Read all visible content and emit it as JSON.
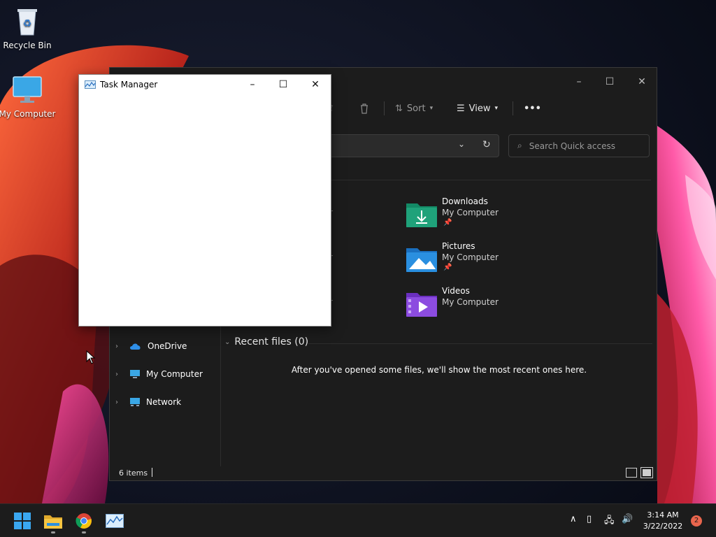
{
  "desktop": {
    "icons": [
      {
        "label": "Recycle Bin",
        "icon": "recycle-bin-icon"
      },
      {
        "label": "My Computer",
        "icon": "computer-icon"
      }
    ]
  },
  "explorer": {
    "toolbar": {
      "sort_label": "Sort",
      "view_label": "View",
      "more_label": "•••"
    },
    "search": {
      "placeholder": "Search Quick access"
    },
    "quick_access": [
      {
        "name": "Downloads",
        "location": "My Computer",
        "pinned": true,
        "icon": "downloads-folder-icon",
        "color": "#1fa27a"
      },
      {
        "name": "Pictures",
        "location": "My Computer",
        "pinned": true,
        "icon": "pictures-folder-icon",
        "color": "#2a8fe0"
      },
      {
        "name": "Videos",
        "location": "My Computer",
        "pinned": false,
        "icon": "videos-folder-icon",
        "color": "#8c4ce0"
      }
    ],
    "nav": [
      {
        "label": "OneDrive",
        "icon": "onedrive-icon"
      },
      {
        "label": "My Computer",
        "icon": "computer-icon"
      },
      {
        "label": "Network",
        "icon": "network-icon"
      }
    ],
    "recent": {
      "header": "Recent files (0)",
      "empty_message": "After you've opened some files, we'll show the most recent ones here."
    },
    "status": {
      "count": "6 items"
    }
  },
  "task_manager": {
    "title": "Task Manager"
  },
  "taskbar": {
    "apps": [
      "start-icon",
      "file-explorer-icon",
      "chrome-icon",
      "task-manager-icon"
    ],
    "time": "3:14 AM",
    "date": "3/22/2022",
    "notifications": "2"
  }
}
